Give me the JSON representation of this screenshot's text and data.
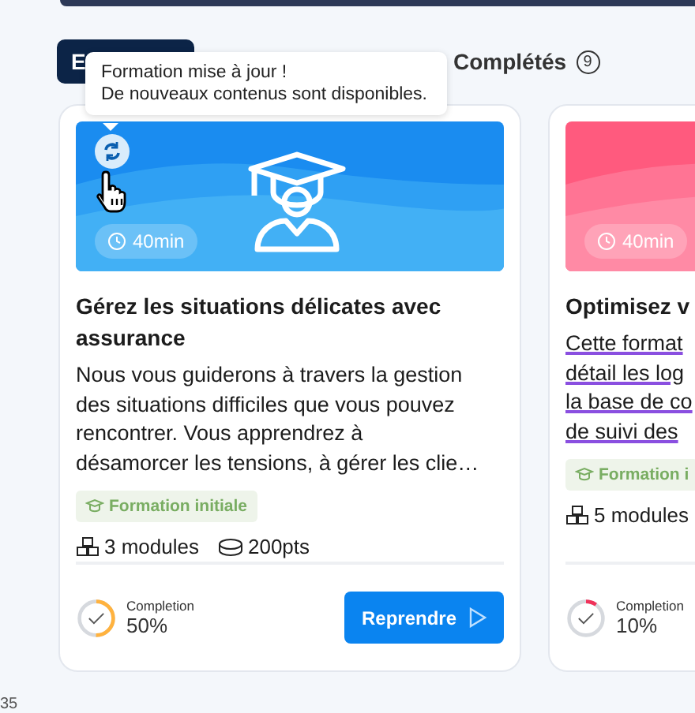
{
  "tabs": [
    {
      "label": "E",
      "selected": true
    },
    {
      "label": "Complétés",
      "count": "9",
      "selected": false
    }
  ],
  "tooltip": {
    "lines": [
      "Formation mise à jour !",
      "De nouveaux contenus sont disponibles."
    ]
  },
  "cards": [
    {
      "updated": true,
      "color": "#1a8cf0",
      "duration": "40min",
      "title": "Gérez les situations délicates avec assurance",
      "description_lines": [
        "Nous vous guiderons à travers la gestion",
        "des situations difficiles que vous pouvez",
        "rencontrer. Vous apprendrez à",
        "désamorcer les tensions, à gérer les clie…"
      ],
      "underlined": false,
      "tag": "Formation initiale",
      "modules": "3 modules",
      "points": "200pts",
      "completion_label": "Completion",
      "completion": "50%",
      "level": 0.5,
      "action": "Reprendre"
    },
    {
      "updated": false,
      "color": "#ff5a7e",
      "duration": "40min",
      "title": "Optimisez v",
      "description_lines": [
        "Cette format",
        "détail les log",
        "la base de co",
        "de suivi des"
      ],
      "underlined": true,
      "tag": "Formation i",
      "modules": "5 modules",
      "completion_label": "Completion",
      "completion": "10%",
      "level": 0.1
    }
  ],
  "footer": "35"
}
